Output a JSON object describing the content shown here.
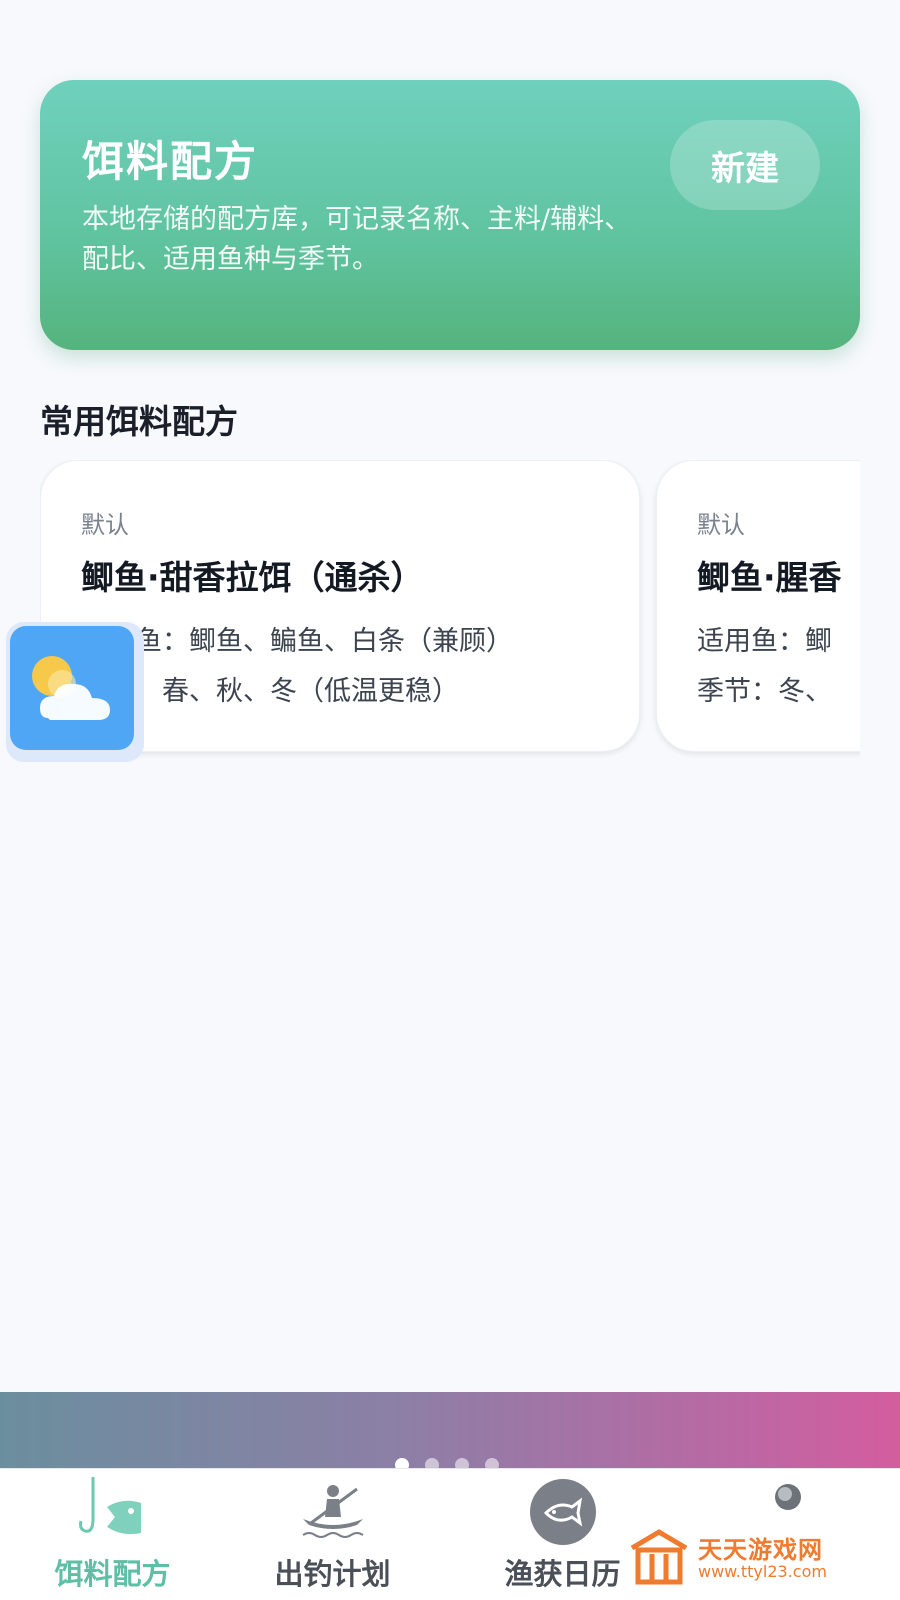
{
  "hero": {
    "title": "饵料配方",
    "description": "本地存储的配方库，可记录名称、主料/辅料、配比、适用鱼种与季节。",
    "new_button": "新建"
  },
  "section_title": "常用饵料配方",
  "recipes": [
    {
      "tag": "默认",
      "name": "鲫鱼·甜香拉饵（通杀）",
      "fish": "适用鱼：鲫鱼、鳊鱼、白条（兼顾）",
      "season": "季节：春、秋、冬（低温更稳）"
    },
    {
      "tag": "默认",
      "name": "鲫鱼·腥香",
      "fish": "适用鱼：鲫",
      "season": "季节：冬、"
    }
  ],
  "weather_widget": {
    "icon": "weather-sun-cloud-icon"
  },
  "banner": {
    "dot_count": 4,
    "active_dot": 0
  },
  "tabs": [
    {
      "label": "饵料配方",
      "icon": "fishing-hook-fish-icon",
      "active": true
    },
    {
      "label": "出钓计划",
      "icon": "kayak-paddler-icon",
      "active": false
    },
    {
      "label": "渔获日历",
      "icon": "fish-circle-icon",
      "active": false
    },
    {
      "label": "",
      "icon": "partial-circle-icon",
      "active": false
    }
  ],
  "watermark": {
    "name": "天天游戏网",
    "url": "www.ttyl23.com"
  },
  "colors": {
    "accent": "#5fbfa6",
    "hero_gradient_top": "#6fd1bd",
    "hero_gradient_bottom": "#56b37d",
    "watermark": "#f07a2e"
  }
}
